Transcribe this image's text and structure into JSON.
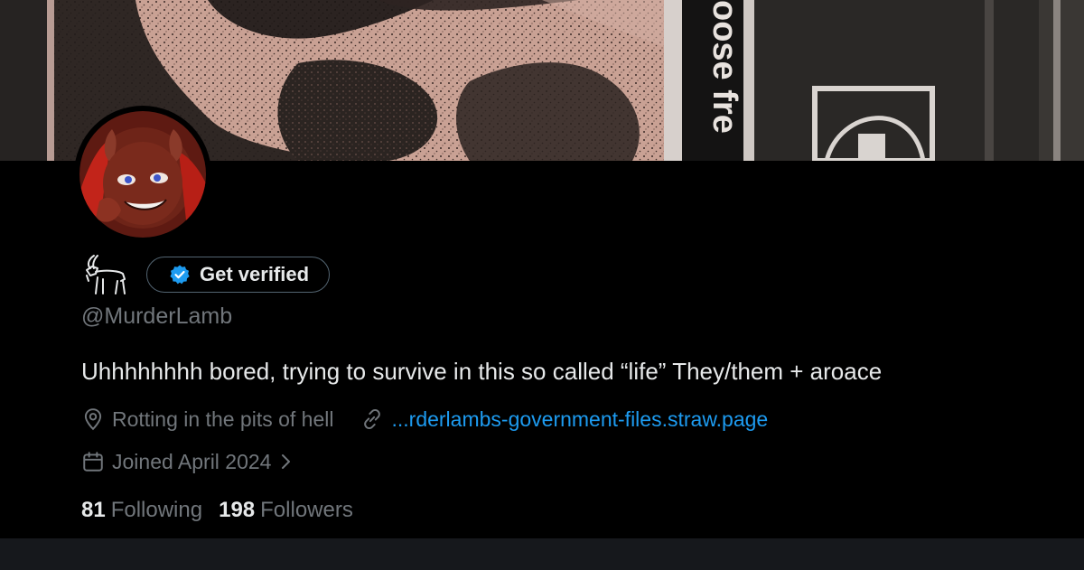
{
  "banner": {
    "alt_text": "",
    "sign_text": "oose fre",
    "colors": {
      "skin": "#c9a194",
      "dark": "#1c1a19",
      "panel": "#2a2826"
    }
  },
  "profile": {
    "avatar_icon": "devil-goat-avatar",
    "display_name_icon": "goat-icon",
    "verify_label": "Get verified",
    "verify_icon": "verified-badge-icon",
    "handle": "@MurderLamb",
    "bio": "Uhhhhhhhh bored, trying to survive in this so called “life” They/them + aroace",
    "location_icon": "location-pin-icon",
    "location": "Rotting in the pits of hell",
    "link_icon": "link-icon",
    "website": "...rderlambs-government-files.straw.page",
    "joined_icon": "calendar-icon",
    "joined": "Joined April 2024",
    "joined_chevron_icon": "chevron-right-icon"
  },
  "stats": {
    "following_count": "81",
    "following_label": "Following",
    "followers_count": "198",
    "followers_label": "Followers"
  },
  "colors": {
    "accent": "#1d9bf0",
    "text_primary": "#e7e9ea",
    "text_secondary": "#71767b",
    "background": "#000000",
    "border": "#536471"
  }
}
